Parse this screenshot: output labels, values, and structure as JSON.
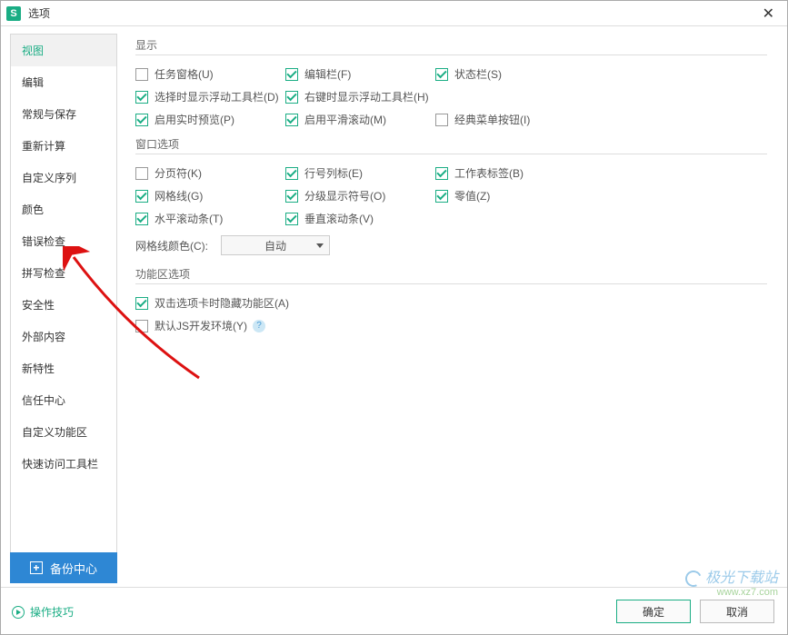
{
  "titlebar": {
    "icon": "S",
    "title": "选项"
  },
  "sidebar": {
    "items": [
      {
        "label": "视图",
        "active": true
      },
      {
        "label": "编辑"
      },
      {
        "label": "常规与保存"
      },
      {
        "label": "重新计算"
      },
      {
        "label": "自定义序列"
      },
      {
        "label": "颜色"
      },
      {
        "label": "错误检查"
      },
      {
        "label": "拼写检查"
      },
      {
        "label": "安全性"
      },
      {
        "label": "外部内容"
      },
      {
        "label": "新特性"
      },
      {
        "label": "信任中心"
      },
      {
        "label": "自定义功能区"
      },
      {
        "label": "快速访问工具栏"
      }
    ]
  },
  "sections": {
    "display": {
      "title": "显示",
      "rows": [
        [
          {
            "label": "任务窗格(U)",
            "checked": false
          },
          {
            "label": "编辑栏(F)",
            "checked": true
          },
          {
            "label": "状态栏(S)",
            "checked": true
          }
        ],
        [
          {
            "label": "选择时显示浮动工具栏(D)",
            "checked": true
          },
          {
            "label": "右键时显示浮动工具栏(H)",
            "checked": true
          }
        ],
        [
          {
            "label": "启用实时预览(P)",
            "checked": true
          },
          {
            "label": "启用平滑滚动(M)",
            "checked": true
          },
          {
            "label": "经典菜单按钮(I)",
            "checked": false
          }
        ]
      ]
    },
    "window": {
      "title": "窗口选项",
      "rows": [
        [
          {
            "label": "分页符(K)",
            "checked": false
          },
          {
            "label": "行号列标(E)",
            "checked": true
          },
          {
            "label": "工作表标签(B)",
            "checked": true
          }
        ],
        [
          {
            "label": "网格线(G)",
            "checked": true
          },
          {
            "label": "分级显示符号(O)",
            "checked": true
          },
          {
            "label": "零值(Z)",
            "checked": true
          }
        ],
        [
          {
            "label": "水平滚动条(T)",
            "checked": true
          },
          {
            "label": "垂直滚动条(V)",
            "checked": true
          }
        ]
      ],
      "gridcolor_label": "网格线颜色(C):",
      "gridcolor_value": "自动"
    },
    "ribbon": {
      "title": "功能区选项",
      "items": [
        {
          "label": "双击选项卡时隐藏功能区(A)",
          "checked": true,
          "help": false
        },
        {
          "label": "默认JS开发环境(Y)",
          "checked": false,
          "help": true
        }
      ]
    }
  },
  "footer": {
    "backup": "备份中心",
    "tips": "操作技巧",
    "ok": "确定",
    "cancel": "取消"
  },
  "watermark": {
    "line1": "极光下载站",
    "line2": "www.xz7.com"
  }
}
